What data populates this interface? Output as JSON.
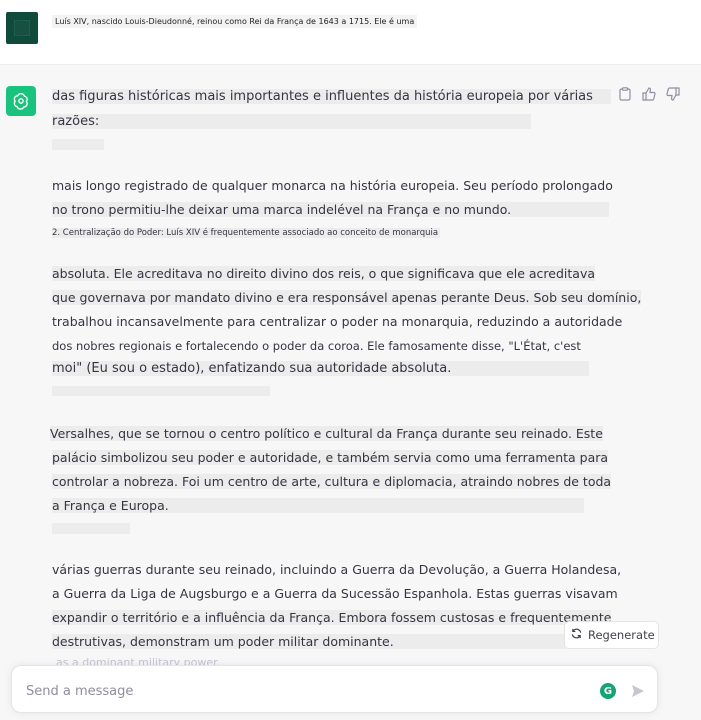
{
  "user_message": {
    "text": "Luís XIV, nascido Louis-Dieudonné, reinou como Rei da França de 1643 a 1715. Ele é uma"
  },
  "assistant": {
    "paragraphs": [
      {
        "lines": [
          "das figuras históricas mais importantes e influentes da história europeia por várias",
          "razões:"
        ]
      },
      {
        "lines": [
          "mais longo registrado de qualquer monarca na história europeia. Seu período prolongado",
          "no trono permitiu-lhe deixar uma marca indelével na França e no mundo.",
          "2. Centralização do Poder: Luís XIV é frequentemente associado ao conceito de monarquia"
        ]
      },
      {
        "lines": [
          "absoluta. Ele acreditava no direito divino dos reis, o que significava que ele acreditava",
          "que governava por mandato divino e era responsável apenas perante Deus. Sob seu domínio,",
          "trabalhou incansavelmente para centralizar o poder na monarquia, reduzindo a autoridade",
          "dos nobres regionais e fortalecendo o poder da coroa. Ele famosamente disse, \"L'État, c'est",
          "moi\" (Eu sou o estado), enfatizando sua autoridade absoluta."
        ]
      },
      {
        "lines": [
          "Versalhes, que se tornou o centro político e cultural da França durante seu reinado. Este",
          "palácio simbolizou seu poder e autoridade, e também servia como uma ferramenta para",
          "controlar a nobreza. Foi um centro de arte, cultura e diplomacia, atraindo nobres de toda",
          "a França e Europa."
        ]
      },
      {
        "lines": [
          "várias guerras durante seu reinado, incluindo a Guerra da Devolução, a Guerra Holandesa,",
          "a Guerra da Liga de Augsburgo e a Guerra da Sucessão Espanhola. Estas guerras visavam",
          "expandir o território e a influência da França. Embora fossem custosas e frequentemente",
          "destrutivas, demonstram um poder militar dominante."
        ]
      }
    ],
    "trailing_ghost": "as a dominant military power."
  },
  "regenerate_label": "Regenerate",
  "composer": {
    "placeholder": "Send a message",
    "value": ""
  },
  "icons": {
    "copy": "clipboard-icon",
    "thumbs_up": "thumbs-up-icon",
    "thumbs_down": "thumbs-down-icon",
    "regenerate": "refresh-icon",
    "send": "send-icon",
    "assistant_logo": "openai-logo-icon",
    "grammarly": "grammarly-icon"
  },
  "colors": {
    "assistant_logo_bg": "#19c37d",
    "user_avatar_bg": "#0f4a3a",
    "grammarly": "#15a474"
  }
}
